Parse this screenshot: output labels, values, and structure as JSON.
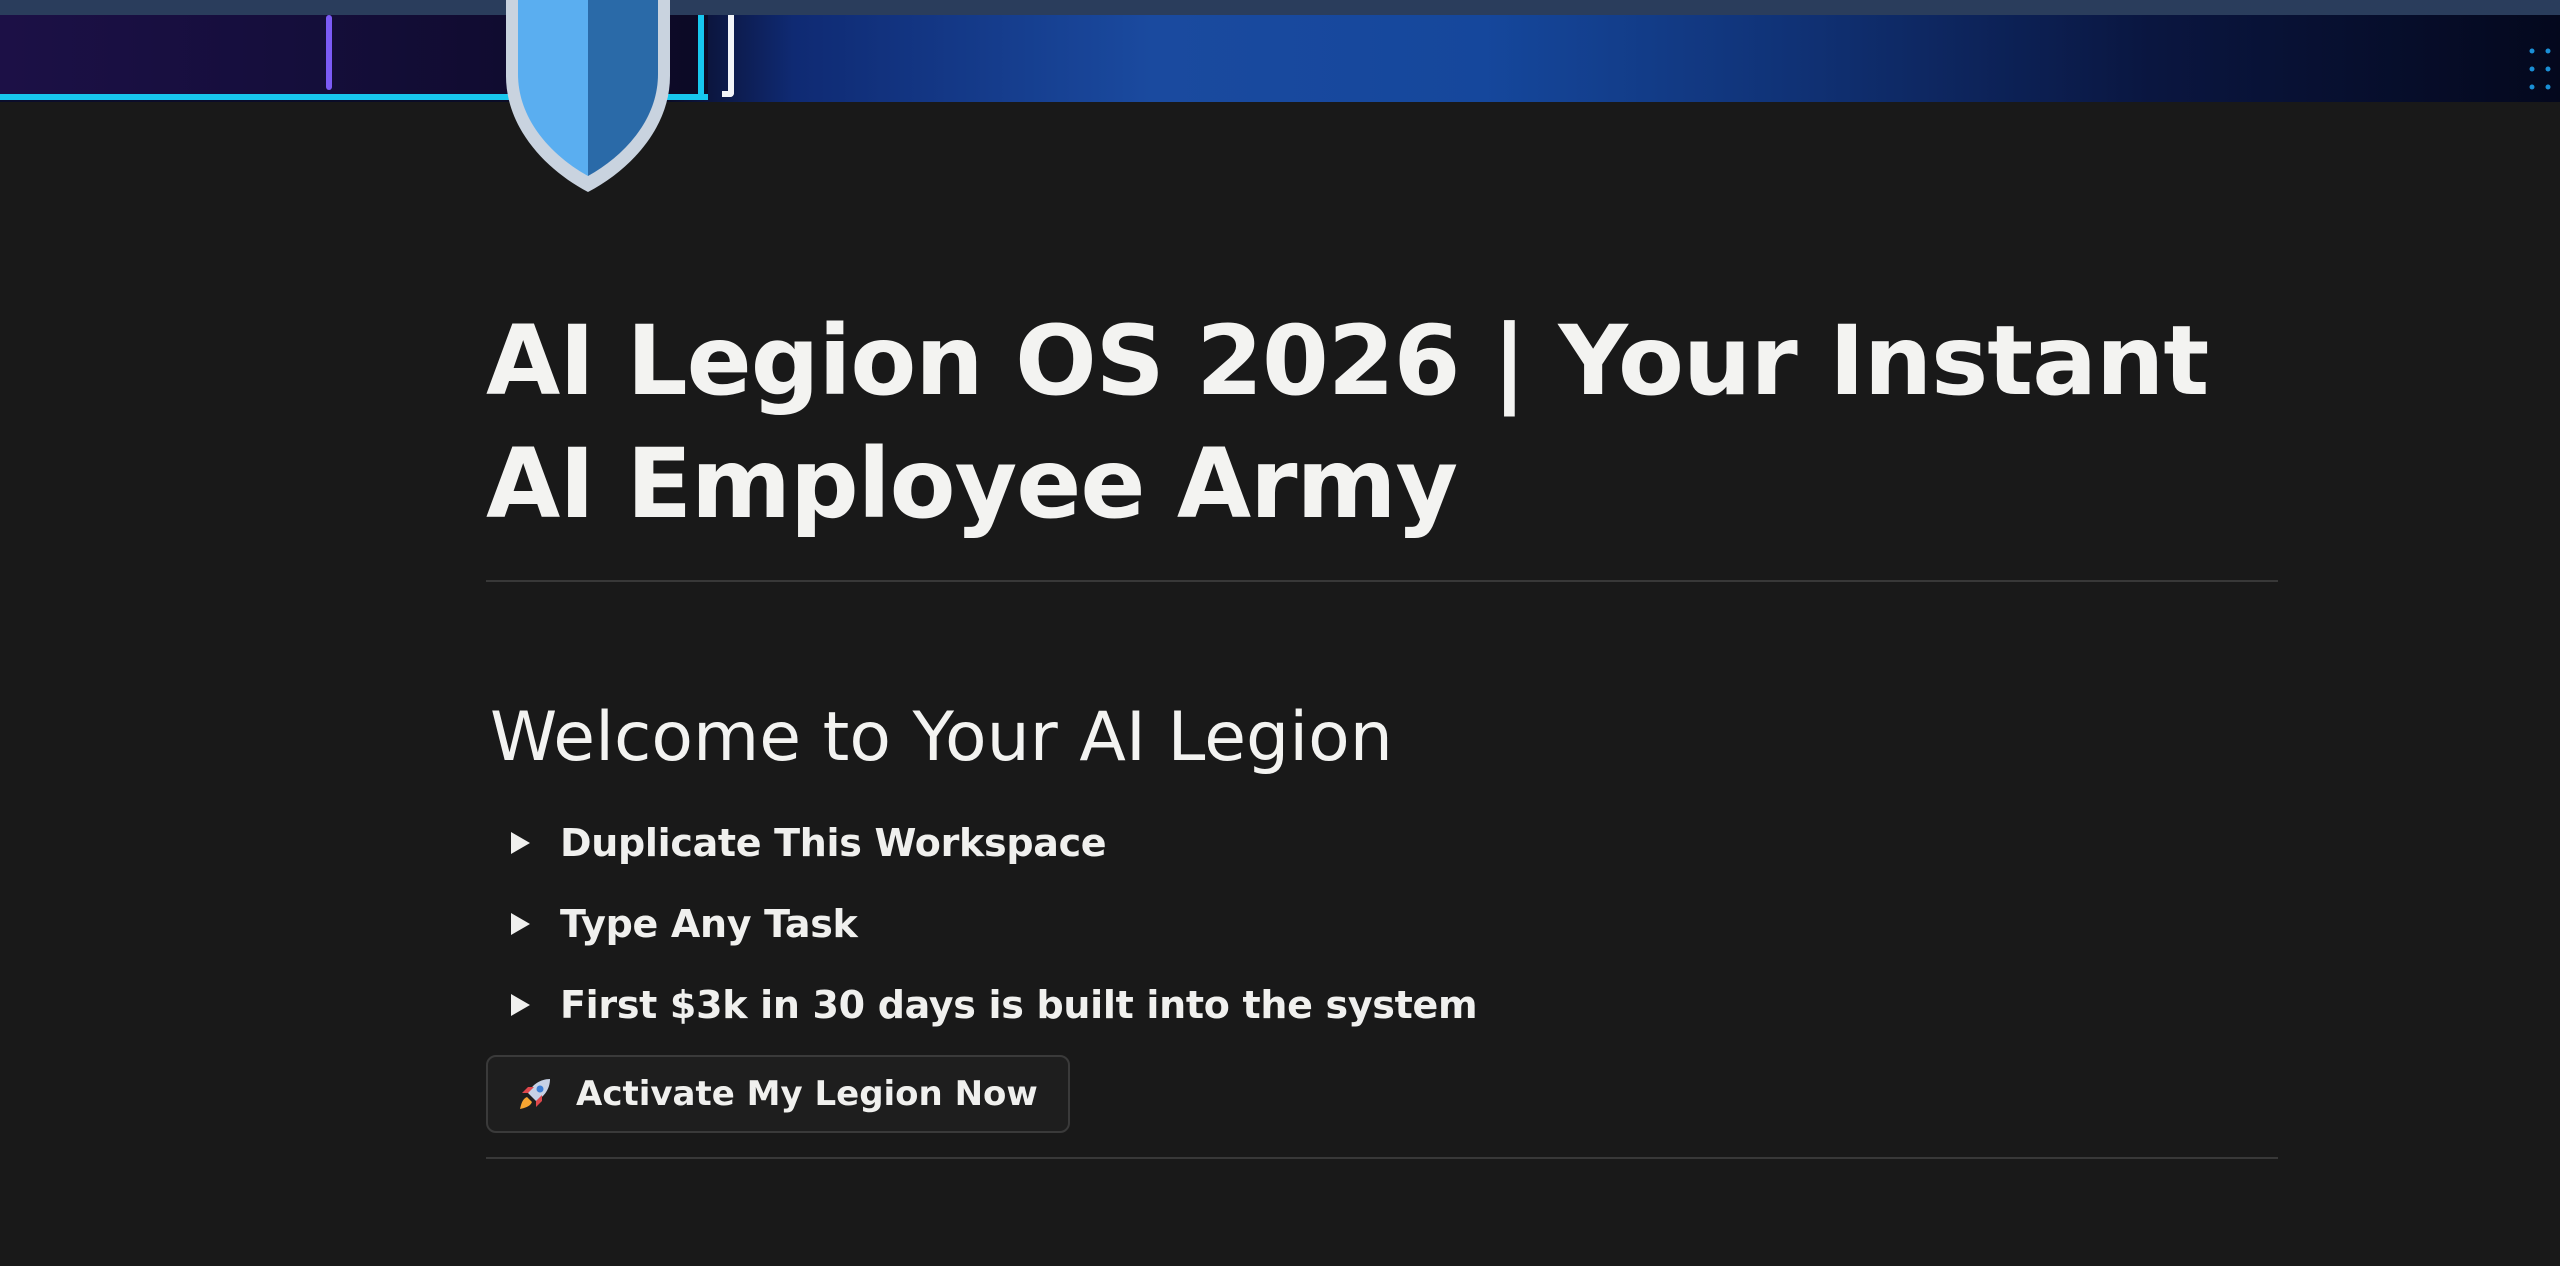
{
  "page": {
    "title": "AI Legion OS 2026 | Your Instant AI Employee Army",
    "icon": "shield-icon"
  },
  "cover": {
    "description_colors": {
      "accent_cyan": "#17c7ee",
      "accent_blue": "#1a4a9f",
      "accent_purple": "#7b5bf5"
    }
  },
  "section": {
    "heading": "Welcome to Your AI Legion",
    "toggles": [
      {
        "label": "Duplicate This Workspace",
        "icon": "triangle-right-icon"
      },
      {
        "label": "Type Any Task",
        "icon": "triangle-right-icon"
      },
      {
        "label": "First $3k in 30 days is built into the system",
        "icon": "triangle-right-icon"
      }
    ],
    "button": {
      "label": "Activate My Legion Now",
      "icon": "rocket-icon"
    }
  },
  "colors": {
    "background": "#191919",
    "text": "#f0f0ee",
    "divider": "#383838"
  }
}
